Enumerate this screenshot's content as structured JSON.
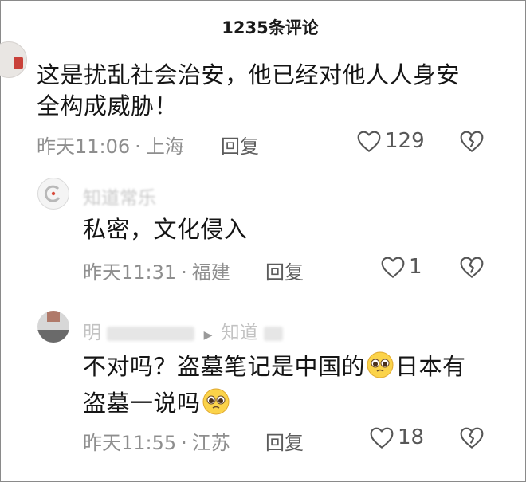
{
  "header": {
    "title": "1235条评论"
  },
  "comments": [
    {
      "text_line1": "这是扰乱社会治安，他已经对他人人身安",
      "text_line2": "全构成威胁！",
      "time": "昨天11:06",
      "location": "上海",
      "reply_label": "回复",
      "likes": "129"
    },
    {
      "author": "知道常乐",
      "text": "私密，文化侵入",
      "time": "昨天11:31",
      "location": "福建",
      "reply_label": "回复",
      "likes": "1"
    },
    {
      "author": "明",
      "reply_to": "知道",
      "text_part1": "不对吗？盗墓笔记是中国的",
      "text_part2": "日本有",
      "text_line2": "盗墓一说吗",
      "time": "昨天11:55",
      "location": "江苏",
      "reply_label": "回复",
      "likes": "18"
    }
  ],
  "separator": "·",
  "reply_arrow": "▶",
  "icons": {
    "like": "heart-outline-icon",
    "dislike": "broken-heart-icon",
    "emoji": "pleading-face-emoji"
  },
  "colors": {
    "text": "#151515",
    "meta": "#8e8e8e",
    "icon": "#555555"
  }
}
